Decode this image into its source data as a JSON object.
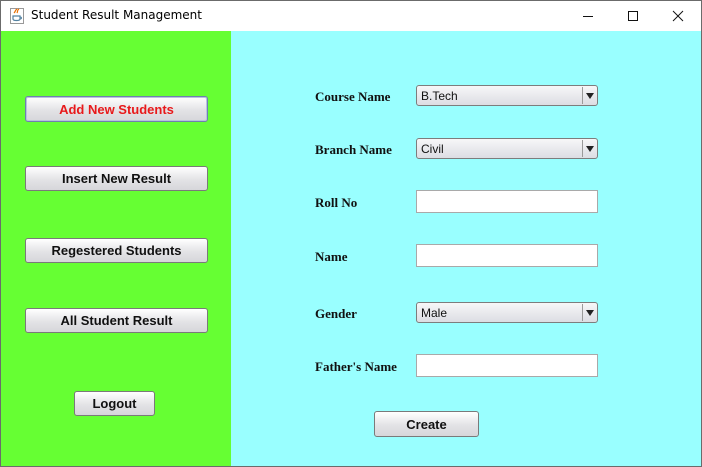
{
  "window": {
    "title": "Student Result Management",
    "app_icon": "java-cup-icon",
    "controls": [
      "minimize-icon",
      "maximize-icon",
      "close-icon"
    ]
  },
  "colors": {
    "left_panel": "#66ff33",
    "right_panel": "#99ffff",
    "accent_text": "#e8191b"
  },
  "sidebar": {
    "add_new_students": "Add New Students",
    "insert_new_result": "Insert New Result",
    "registered_students": "Regestered Students",
    "all_student_result": "All Student Result",
    "logout": "Logout"
  },
  "form": {
    "course_label": "Course Name",
    "course_value": "B.Tech",
    "branch_label": "Branch Name",
    "branch_value": "Civil",
    "rollno_label": "Roll No",
    "rollno_value": "",
    "name_label": "Name",
    "name_value": "",
    "gender_label": "Gender",
    "gender_value": "Male",
    "father_label": "Father's Name",
    "father_value": "",
    "create_label": "Create"
  }
}
